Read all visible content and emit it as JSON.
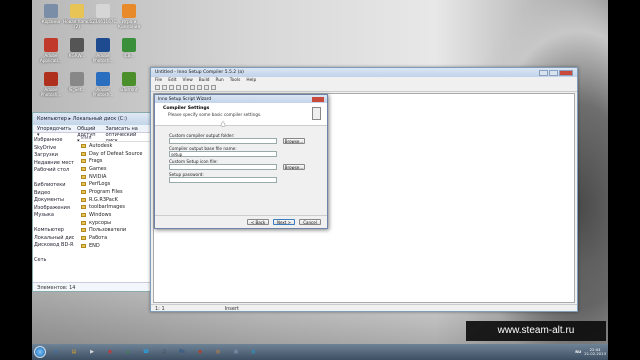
{
  "desktop_icons": [
    {
      "label": "Корзина",
      "color": "#7a8ea8"
    },
    {
      "label": "Новая папка (2)",
      "color": "#e8c455"
    },
    {
      "label": "523461167C",
      "color": "#d6d6d6"
    },
    {
      "label": "Игра и Компания",
      "color": "#e88a2a"
    },
    {
      "label": "Adobe Applicati...",
      "color": "#c0392b"
    },
    {
      "label": "KGRW...",
      "color": "#555"
    },
    {
      "label": "Adobe Photosh...",
      "color": "#1e4b8f"
    },
    {
      "label": "ICB...",
      "color": "#3a8f3a"
    },
    {
      "label": "Adobe Photosh...",
      "color": "#b0301e"
    },
    {
      "label": "IS_Set...",
      "color": "#888"
    },
    {
      "label": "Adobe Photosh...",
      "color": "#2a6fbf"
    },
    {
      "label": "uTorrent",
      "color": "#4b8f2a"
    }
  ],
  "explorer": {
    "breadcrumb": "Компьютер ▸ Локальный диск (C:)",
    "toolbar": [
      "Упорядочить ▾",
      "Общий доступ ▾",
      "Записать на оптический диск"
    ],
    "column_header": "Имя",
    "nav": [
      "Избранное",
      "SkyDrive",
      "Загрузки",
      "Недавние места",
      "Рабочий стол",
      "",
      "Библиотеки",
      "Видео",
      "Документы",
      "Изображения",
      "Музыка",
      "",
      "Компьютер",
      "Локальный диск (C:)",
      "Дисковод BD-ROM",
      "",
      "Сеть"
    ],
    "files": [
      "Autodesk",
      "Day of Defeat Source",
      "Frags",
      "Games",
      "NVIDIA",
      "PerfLogs",
      "Program Files",
      "R.G.R3PacK",
      "toolbarImages",
      "Windows",
      "курсоры",
      "Пользователи",
      "Работа",
      "END"
    ],
    "status": "Элементов: 14"
  },
  "inno": {
    "title": "Untitled - Inno Setup Compiler 5.5.2 (a)",
    "menu": [
      "File",
      "Edit",
      "View",
      "Build",
      "Run",
      "Tools",
      "Help"
    ],
    "status_pos": "1: 1",
    "status_mode": "Insert"
  },
  "wizard": {
    "title": "Inno Setup Script Wizard",
    "heading": "Compiler Settings",
    "subheading": "Please specify some basic compiler settings.",
    "field1_label": "Custom compiler output folder:",
    "field1_value": "",
    "field2_label": "Compiler output base file name:",
    "field2_value": "setup",
    "field3_label": "Custom Setup icon file:",
    "field3_value": "",
    "field4_label": "Setup password:",
    "field4_value": "",
    "browse": "Browse...",
    "back": "< Back",
    "next": "Next >",
    "cancel": "Cancel"
  },
  "taskbar": {
    "apps": [
      {
        "glyph": "e",
        "color": "#2a6fbf"
      },
      {
        "glyph": "▤",
        "color": "#d9a32b"
      },
      {
        "glyph": "▶",
        "color": "#ddd"
      },
      {
        "glyph": "◉",
        "color": "#c33"
      },
      {
        "glyph": "µ",
        "color": "#3a8f3a"
      },
      {
        "glyph": "☎",
        "color": "#2aa0e0"
      },
      {
        "glyph": "♫",
        "color": "#444"
      },
      {
        "glyph": "Ps",
        "color": "#1e4b8f"
      },
      {
        "glyph": "◆",
        "color": "#b83a2e"
      },
      {
        "glyph": "◎",
        "color": "#e88a2a"
      },
      {
        "glyph": "▣",
        "color": "#7a8ea8"
      },
      {
        "glyph": "◐",
        "color": "#2a8fbf"
      }
    ],
    "lang": "RU",
    "time": "22:04",
    "date": "21.02.2013"
  },
  "watermark": "www.steam-alt.ru"
}
